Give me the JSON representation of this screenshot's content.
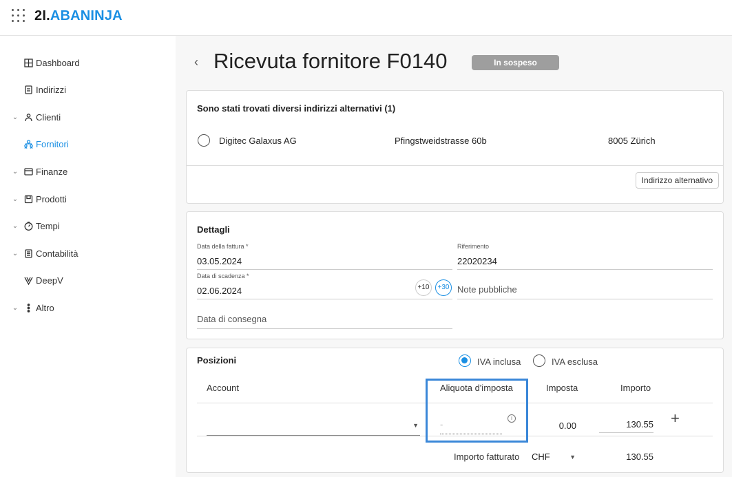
{
  "app": {
    "logo_num": "2I.",
    "logo_brand": "ABANINJA"
  },
  "sidebar": {
    "items": [
      {
        "label": "Dashboard",
        "icon": "dashboard-icon",
        "expandable": false,
        "active": false
      },
      {
        "label": "Indirizzi",
        "icon": "contacts-icon",
        "expandable": false,
        "active": false
      },
      {
        "label": "Clienti",
        "icon": "people-icon",
        "expandable": true,
        "active": false
      },
      {
        "label": "Fornitori",
        "icon": "suppliers-icon",
        "expandable": false,
        "active": true
      },
      {
        "label": "Finanze",
        "icon": "wallet-icon",
        "expandable": true,
        "active": false
      },
      {
        "label": "Prodotti",
        "icon": "box-icon",
        "expandable": true,
        "active": false
      },
      {
        "label": "Tempi",
        "icon": "clock-icon",
        "expandable": true,
        "active": false
      },
      {
        "label": "Contabilità",
        "icon": "ledger-icon",
        "expandable": true,
        "active": false
      },
      {
        "label": "DeepV",
        "icon": "deepv-icon",
        "expandable": false,
        "active": false
      },
      {
        "label": "Altro",
        "icon": "more-vertical-icon",
        "expandable": true,
        "active": false
      }
    ]
  },
  "header": {
    "title": "Ricevuta fornitore F0140",
    "status": "In sospeso"
  },
  "alt_addresses": {
    "title": "Sono stati trovati diversi indirizzi alternativi (1)",
    "entries": [
      {
        "name": "Digitec Galaxus AG",
        "street": "Pfingstweidstrasse 60b",
        "city": "8005 Zürich"
      }
    ],
    "button_label": "Indirizzo alternativo"
  },
  "details": {
    "title": "Dettagli",
    "invoice_date_label": "Data della fattura *",
    "invoice_date_value": "03.05.2024",
    "reference_label": "Riferimento",
    "reference_value": "22020234",
    "due_date_label": "Data di scadenza *",
    "due_date_value": "02.06.2024",
    "plus10": "+10",
    "plus30": "+30",
    "public_notes_placeholder": "Note pubbliche",
    "delivery_date_placeholder": "Data di consegna"
  },
  "positions": {
    "title": "Posizioni",
    "vat_included_label": "IVA inclusa",
    "vat_excluded_label": "IVA esclusa",
    "vat_mode": "included",
    "col_account": "Account",
    "col_tax_rate": "Aliquota d'imposta",
    "col_tax": "Imposta",
    "col_amount": "Importo",
    "row": {
      "account": "",
      "tax_rate": "-",
      "tax": "0.00",
      "amount": "130.55"
    },
    "billed_label": "Importo fatturato",
    "currency": "CHF",
    "billed_value": "130.55"
  },
  "colors": {
    "accent": "#1a8fe3",
    "badge": "#9e9e9e",
    "highlight": "#3a87d8"
  }
}
